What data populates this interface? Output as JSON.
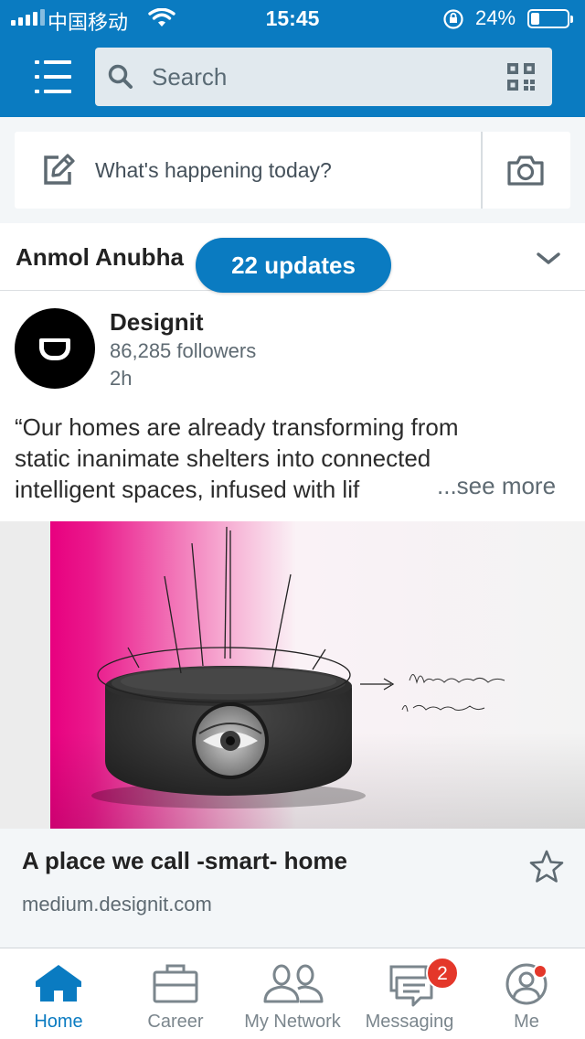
{
  "status_bar": {
    "carrier": "中国移动",
    "time": "15:45",
    "battery_percent_label": "24%",
    "battery_level": 0.24
  },
  "header": {
    "search_placeholder": "Search",
    "accent_color": "#0a7bc1"
  },
  "share_box": {
    "prompt": "What's happening today?"
  },
  "feed": {
    "notification_name": "Anmol Anubha",
    "updates_pill": "22 updates",
    "post": {
      "author": "Designit",
      "followers": "86,285 followers",
      "age": "2h",
      "text_lines": [
        "“Our homes are already transforming from",
        "static inanimate shelters into connected",
        "intelligent spaces, infused with lif"
      ],
      "see_more": "...see more",
      "image_handwriting": [
        "Welcome back",
        "I missed you"
      ],
      "link_title": "A place we call -smart- home",
      "link_domain": "medium.designit.com"
    }
  },
  "tabbar": {
    "tabs": [
      {
        "label": "Home",
        "icon": "home-icon",
        "active": true
      },
      {
        "label": "Career",
        "icon": "briefcase-icon",
        "active": false
      },
      {
        "label": "My Network",
        "icon": "people-icon",
        "active": false
      },
      {
        "label": "Messaging",
        "icon": "chat-icon",
        "active": false
      },
      {
        "label": "Me",
        "icon": "profile-icon",
        "active": false
      }
    ],
    "messaging_badge": "2",
    "badge_color": "#e4372a"
  }
}
